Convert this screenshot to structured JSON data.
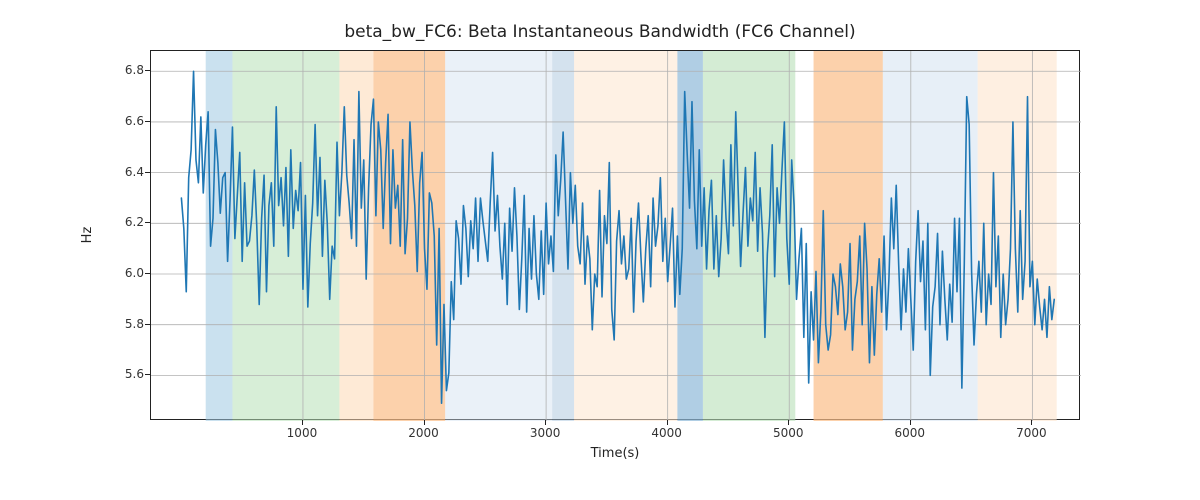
{
  "chart_data": {
    "type": "line",
    "title": "beta_bw_FC6: Beta Instantaneous Bandwidth (FC6 Channel)",
    "xlabel": "Time(s)",
    "ylabel": "Hz",
    "xlim": [
      -250,
      7400
    ],
    "ylim": [
      5.42,
      6.88
    ],
    "xticks": [
      1000,
      2000,
      3000,
      4000,
      5000,
      6000,
      7000
    ],
    "yticks": [
      5.6,
      5.8,
      6.0,
      6.2,
      6.4,
      6.6,
      6.8
    ],
    "grid": true,
    "line_color": "#1f77b4",
    "bands": [
      {
        "x0": 200,
        "x1": 420,
        "color": "#9ec9e2",
        "alpha": 0.55
      },
      {
        "x0": 420,
        "x1": 1300,
        "color": "#b7e0b7",
        "alpha": 0.55
      },
      {
        "x0": 1300,
        "x1": 1580,
        "color": "#fdd9b5",
        "alpha": 0.55
      },
      {
        "x0": 1580,
        "x1": 2170,
        "color": "#fbbd87",
        "alpha": 0.7
      },
      {
        "x0": 2170,
        "x1": 3050,
        "color": "#d0dff0",
        "alpha": 0.45
      },
      {
        "x0": 3050,
        "x1": 3230,
        "color": "#a9c6de",
        "alpha": 0.5
      },
      {
        "x0": 3230,
        "x1": 4080,
        "color": "#fde5cd",
        "alpha": 0.55
      },
      {
        "x0": 4080,
        "x1": 4290,
        "color": "#8fb9d8",
        "alpha": 0.7
      },
      {
        "x0": 4290,
        "x1": 5050,
        "color": "#b7e0b7",
        "alpha": 0.6
      },
      {
        "x0": 5200,
        "x1": 5770,
        "color": "#fbbd87",
        "alpha": 0.7
      },
      {
        "x0": 5770,
        "x1": 6550,
        "color": "#cfe0ef",
        "alpha": 0.5
      },
      {
        "x0": 6550,
        "x1": 7200,
        "color": "#fde5cd",
        "alpha": 0.6
      }
    ],
    "series": [
      {
        "name": "beta_bw_FC6",
        "x_sample_step": 20,
        "values": [
          6.3,
          6.18,
          5.93,
          6.38,
          6.49,
          6.8,
          6.45,
          6.36,
          6.62,
          6.32,
          6.51,
          6.64,
          6.11,
          6.22,
          6.57,
          6.44,
          6.24,
          6.38,
          6.4,
          6.05,
          6.29,
          6.58,
          6.14,
          6.31,
          6.48,
          6.05,
          6.36,
          6.11,
          6.13,
          6.23,
          6.41,
          6.19,
          5.88,
          6.22,
          6.39,
          5.93,
          6.27,
          6.36,
          6.11,
          6.66,
          6.27,
          6.38,
          6.19,
          6.42,
          6.07,
          6.49,
          6.18,
          6.33,
          6.25,
          6.44,
          5.94,
          6.31,
          5.87,
          6.12,
          6.28,
          6.59,
          6.23,
          6.46,
          6.07,
          6.37,
          6.2,
          5.9,
          6.11,
          6.06,
          6.52,
          6.23,
          6.4,
          6.66,
          6.39,
          6.28,
          6.14,
          6.53,
          6.11,
          6.72,
          6.26,
          6.45,
          5.98,
          6.34,
          6.59,
          6.69,
          6.23,
          6.6,
          6.49,
          6.18,
          6.44,
          6.63,
          6.12,
          6.49,
          6.26,
          6.35,
          6.11,
          6.53,
          6.08,
          6.22,
          6.6,
          6.41,
          6.27,
          6.01,
          6.36,
          6.48,
          6.1,
          5.94,
          6.32,
          6.28,
          6.15,
          5.72,
          6.18,
          5.49,
          5.88,
          5.54,
          5.61,
          5.97,
          5.82,
          6.21,
          6.14,
          5.96,
          6.27,
          6.18,
          5.99,
          6.21,
          6.1,
          6.3,
          6.05,
          6.3,
          6.21,
          6.13,
          6.05,
          6.28,
          6.48,
          6.17,
          6.31,
          6.11,
          5.98,
          6.2,
          5.88,
          6.26,
          6.09,
          6.34,
          6.15,
          5.86,
          6.06,
          6.31,
          5.85,
          6.18,
          5.98,
          6.23,
          6.0,
          5.9,
          6.17,
          5.92,
          6.28,
          6.04,
          6.15,
          6.01,
          6.47,
          6.23,
          6.37,
          6.56,
          6.29,
          6.02,
          6.4,
          6.2,
          6.35,
          6.11,
          6.04,
          6.28,
          5.96,
          6.15,
          6.06,
          5.78,
          6.0,
          5.95,
          6.33,
          5.91,
          6.23,
          6.12,
          6.44,
          5.86,
          5.74,
          6.13,
          6.25,
          6.04,
          6.15,
          5.98,
          6.02,
          6.22,
          5.85,
          6.13,
          6.28,
          6.07,
          5.89,
          6.1,
          6.23,
          5.95,
          6.3,
          6.11,
          6.19,
          6.38,
          6.05,
          6.22,
          5.97,
          6.11,
          6.26,
          5.87,
          6.15,
          5.92,
          6.1,
          6.72,
          6.48,
          6.26,
          6.68,
          6.29,
          6.1,
          6.49,
          6.11,
          6.34,
          6.02,
          6.25,
          6.37,
          6.02,
          6.23,
          5.99,
          6.14,
          6.45,
          6.22,
          6.08,
          6.51,
          6.19,
          6.64,
          6.33,
          6.03,
          6.24,
          6.42,
          6.11,
          6.3,
          6.21,
          6.48,
          6.09,
          6.34,
          6.16,
          5.75,
          6.08,
          6.23,
          6.51,
          5.99,
          6.34,
          6.2,
          6.41,
          6.6,
          6.14,
          5.96,
          6.45,
          6.27,
          5.9,
          6.06,
          6.18,
          5.75,
          6.12,
          5.57,
          5.93,
          5.74,
          6.01,
          5.65,
          5.85,
          6.25,
          5.8,
          5.7,
          5.76,
          6.0,
          5.95,
          5.84,
          6.04,
          5.95,
          5.78,
          5.85,
          6.12,
          5.7,
          5.9,
          5.97,
          6.15,
          5.8,
          6.2,
          6.02,
          5.65,
          5.95,
          5.68,
          5.92,
          6.06,
          5.85,
          6.15,
          5.78,
          5.98,
          6.3,
          6.1,
          6.35,
          6.04,
          5.78,
          6.02,
          5.85,
          6.1,
          5.9,
          5.7,
          6.05,
          6.25,
          5.97,
          6.13,
          5.78,
          6.2,
          5.6,
          5.87,
          5.95,
          6.16,
          5.8,
          6.09,
          5.9,
          5.74,
          5.96,
          5.81,
          6.22,
          5.93,
          6.22,
          5.55,
          6.04,
          6.7,
          6.59,
          6.01,
          5.72,
          5.92,
          6.05,
          5.85,
          6.2,
          5.8,
          6.0,
          5.88,
          6.4,
          5.95,
          6.15,
          5.75,
          6.0,
          5.8,
          5.9,
          6.1,
          6.6,
          6.1,
          5.85,
          6.25,
          5.9,
          6.05,
          6.7,
          5.95,
          6.05,
          5.8,
          5.98,
          5.87,
          5.78,
          5.9,
          5.75,
          5.95,
          5.82,
          5.9
        ]
      }
    ]
  }
}
